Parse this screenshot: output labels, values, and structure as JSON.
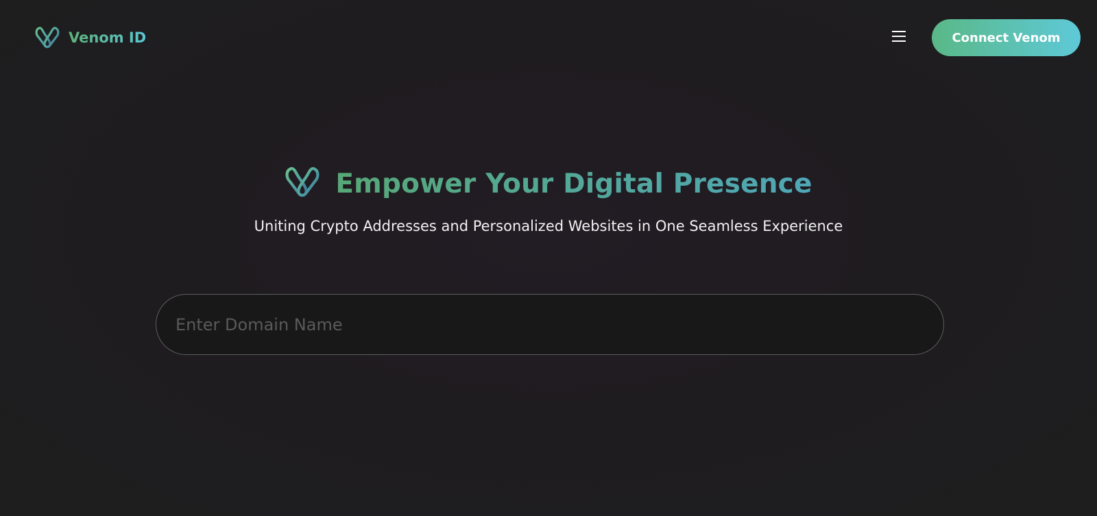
{
  "header": {
    "brand_name": "Venom ID",
    "logo_icon": "venom-heart-logo-icon",
    "menu_icon": "hamburger-menu-icon",
    "connect_label": "Connect Venom"
  },
  "hero": {
    "logo_icon": "venom-heart-logo-icon",
    "title": "Empower Your Digital Presence",
    "subtitle": "Uniting Crypto Addresses and Personalized Websites in One Seamless Experience"
  },
  "search": {
    "placeholder": "Enter Domain Name",
    "value": ""
  },
  "colors": {
    "background": "#1f1c20",
    "accent_green": "#5ab887",
    "accent_cyan": "#5ec9d8",
    "input_border": "#5d5d5f",
    "placeholder": "#5a5a5c"
  }
}
